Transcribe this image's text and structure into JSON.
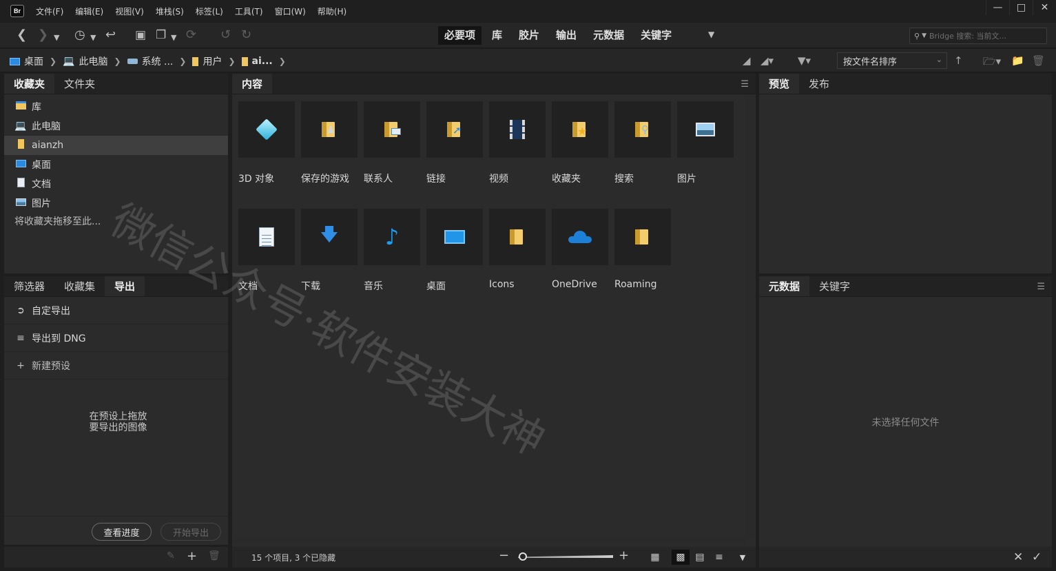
{
  "app": {
    "logo_text": "Br"
  },
  "menu": [
    "文件(F)",
    "编辑(E)",
    "视图(V)",
    "堆栈(S)",
    "标签(L)",
    "工具(T)",
    "窗口(W)",
    "帮助(H)"
  ],
  "window_controls": {
    "minimize": "—",
    "maximize": "□",
    "close": "✕"
  },
  "workspaces": {
    "items": [
      "必要项",
      "库",
      "胶片",
      "输出",
      "元数据",
      "关键字"
    ],
    "active": "必要项"
  },
  "search": {
    "placeholder": "Bridge 搜索: 当前文..."
  },
  "breadcrumb": [
    {
      "label": "桌面",
      "icon": "desktop-icon"
    },
    {
      "label": "此电脑",
      "icon": "computer-icon"
    },
    {
      "label": "系统 ...",
      "icon": "drive-icon"
    },
    {
      "label": "用户",
      "icon": "folder-icon"
    },
    {
      "label": "ai...",
      "icon": "folder-icon"
    }
  ],
  "sort": {
    "label": "按文件名排序"
  },
  "left_top_panel": {
    "tabs": [
      "收藏夹",
      "文件夹"
    ],
    "favorites": [
      {
        "label": "库",
        "icon": "library-icon"
      },
      {
        "label": "此电脑",
        "icon": "computer-icon"
      },
      {
        "label": "aianzh",
        "icon": "folder-icon",
        "selected": true
      },
      {
        "label": "桌面",
        "icon": "desktop-icon"
      },
      {
        "label": "文档",
        "icon": "document-icon"
      },
      {
        "label": "图片",
        "icon": "pictures-icon"
      }
    ],
    "hint": "将收藏夹拖移至此..."
  },
  "left_bottom_panel": {
    "tabs": [
      "筛选器",
      "收藏集",
      "导出"
    ],
    "export_items": [
      {
        "label": "自定导出",
        "icon": "export-icon"
      },
      {
        "label": "导出到 DNG",
        "icon": "list-icon"
      },
      {
        "label": "新建预设",
        "icon": "plus-icon"
      }
    ],
    "drop_hint_line1": "在预设上拖放",
    "drop_hint_line2": "要导出的图像",
    "view_progress": "查看进度",
    "start_export": "开始导出"
  },
  "content": {
    "tab": "内容",
    "items": [
      {
        "label": "3D 对象",
        "icon": "3d-objects-icon"
      },
      {
        "label": "保存的游戏",
        "icon": "saved-games-icon"
      },
      {
        "label": "联系人",
        "icon": "contacts-icon"
      },
      {
        "label": "链接",
        "icon": "links-icon"
      },
      {
        "label": "视频",
        "icon": "videos-icon"
      },
      {
        "label": "收藏夹",
        "icon": "favorites-icon"
      },
      {
        "label": "搜索",
        "icon": "searches-icon"
      },
      {
        "label": "图片",
        "icon": "pictures-icon"
      },
      {
        "label": "文档",
        "icon": "documents-icon"
      },
      {
        "label": "下载",
        "icon": "downloads-icon"
      },
      {
        "label": "音乐",
        "icon": "music-icon"
      },
      {
        "label": "桌面",
        "icon": "desktop-icon"
      },
      {
        "label": "Icons",
        "icon": "folder-icon"
      },
      {
        "label": "OneDrive",
        "icon": "onedrive-icon"
      },
      {
        "label": "Roaming",
        "icon": "folder-icon"
      }
    ],
    "status": "15 个项目, 3 个已隐藏"
  },
  "right_top_panel": {
    "tabs": [
      "预览",
      "发布"
    ]
  },
  "right_bottom_panel": {
    "tabs": [
      "元数据",
      "关键字"
    ],
    "empty_text": "未选择任何文件"
  },
  "watermark": "微信公众号·软件安装大神"
}
